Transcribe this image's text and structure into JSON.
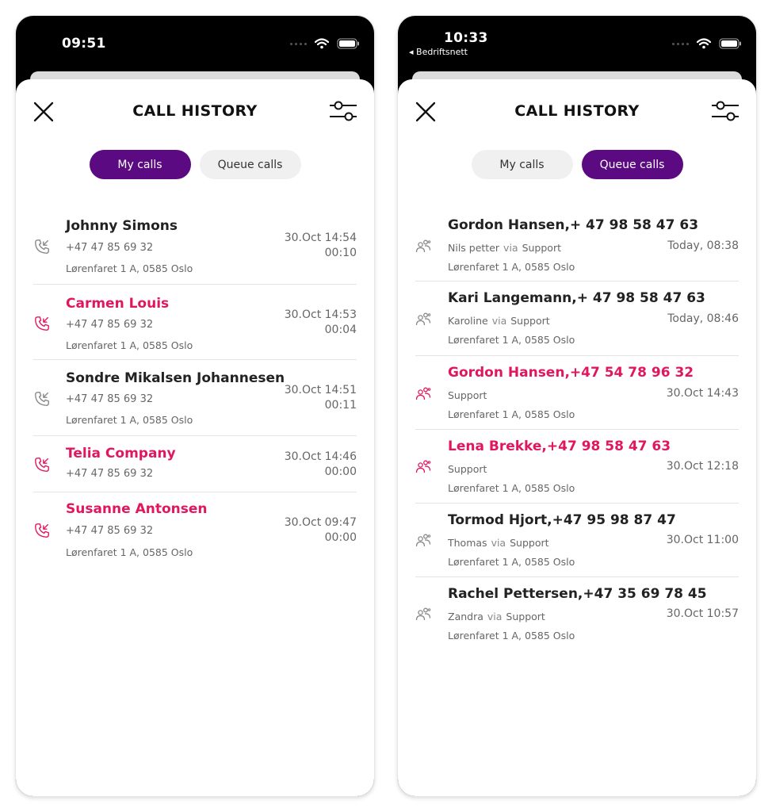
{
  "left_screen": {
    "status": {
      "time": "09:51"
    },
    "header": {
      "title": "CALL HISTORY"
    },
    "tabs": [
      {
        "label": "My calls",
        "active": true
      },
      {
        "label": "Queue calls",
        "active": false
      }
    ],
    "calls": [
      {
        "name": "Johnny Simons",
        "number": "+47 47 85 69 32",
        "address": "Lørenfaret 1 A, 0585 Oslo",
        "date": "30.Oct 14:54",
        "duration": "00:10",
        "missed": false
      },
      {
        "name": "Carmen Louis",
        "number": "+47 47 85 69 32",
        "address": "Lørenfaret 1 A, 0585 Oslo",
        "date": "30.Oct 14:53",
        "duration": "00:04",
        "missed": true
      },
      {
        "name": "Sondre Mikalsen Johannesen",
        "number": "+47 47 85 69 32",
        "address": "Lørenfaret 1 A, 0585 Oslo",
        "date": "30.Oct 14:51",
        "duration": "00:11",
        "missed": false
      },
      {
        "name": "Telia Company",
        "number": "+47 47 85 69 32",
        "address": "",
        "date": "30.Oct 14:46",
        "duration": "00:00",
        "missed": true
      },
      {
        "name": "Susanne Antonsen",
        "number": "+47 47 85 69 32",
        "address": "Lørenfaret 1 A, 0585 Oslo",
        "date": "30.Oct 09:47",
        "duration": "00:00",
        "missed": true
      }
    ]
  },
  "right_screen": {
    "status": {
      "time": "10:33",
      "carrier": "◂ Bedriftsnett"
    },
    "header": {
      "title": "CALL HISTORY"
    },
    "tabs": [
      {
        "label": "My calls",
        "active": false
      },
      {
        "label": "Queue calls",
        "active": true
      }
    ],
    "queue_calls": [
      {
        "caller": "Gordon Hansen,+ 47 98 58 47 63",
        "agent": "Nils petter",
        "via": "via",
        "queue": "Support",
        "address": "Lørenfaret 1 A, 0585 Oslo",
        "date": "Today, 08:38",
        "missed": false
      },
      {
        "caller": "Kari Langemann,+ 47 98 58 47 63",
        "agent": "Karoline",
        "via": "via",
        "queue": "Support",
        "address": "Lørenfaret 1 A, 0585 Oslo",
        "date": "Today, 08:46",
        "missed": false
      },
      {
        "caller": "Gordon Hansen,+47 54 78 96 32",
        "agent": "",
        "via": "",
        "queue": "Support",
        "address": "Lørenfaret 1 A, 0585 Oslo",
        "date": "30.Oct 14:43",
        "missed": true
      },
      {
        "caller": "Lena Brekke,+47 98 58 47 63",
        "agent": "",
        "via": "",
        "queue": "Support",
        "address": "Lørenfaret 1 A, 0585 Oslo",
        "date": "30.Oct 12:18",
        "missed": true
      },
      {
        "caller": "Tormod Hjort,+47 95 98 87 47",
        "agent": "Thomas",
        "via": "via",
        "queue": "Support",
        "address": "Lørenfaret 1 A, 0585 Oslo",
        "date": "30.Oct 11:00",
        "missed": false
      },
      {
        "caller": "Rachel Pettersen,+47 35 69 78 45",
        "agent": "Zandra",
        "via": "via",
        "queue": "Support",
        "address": "Lørenfaret 1 A, 0585 Oslo",
        "date": "30.Oct 10:57",
        "missed": false
      }
    ]
  },
  "colors": {
    "accent": "#5b0a82",
    "missed": "#e0175f",
    "text": "#222222",
    "muted": "#666666"
  },
  "icons": [
    "close-icon",
    "filter-icon",
    "incoming-call-icon",
    "queue-people-icon",
    "wifi-icon",
    "battery-icon",
    "signal-dots-icon"
  ]
}
